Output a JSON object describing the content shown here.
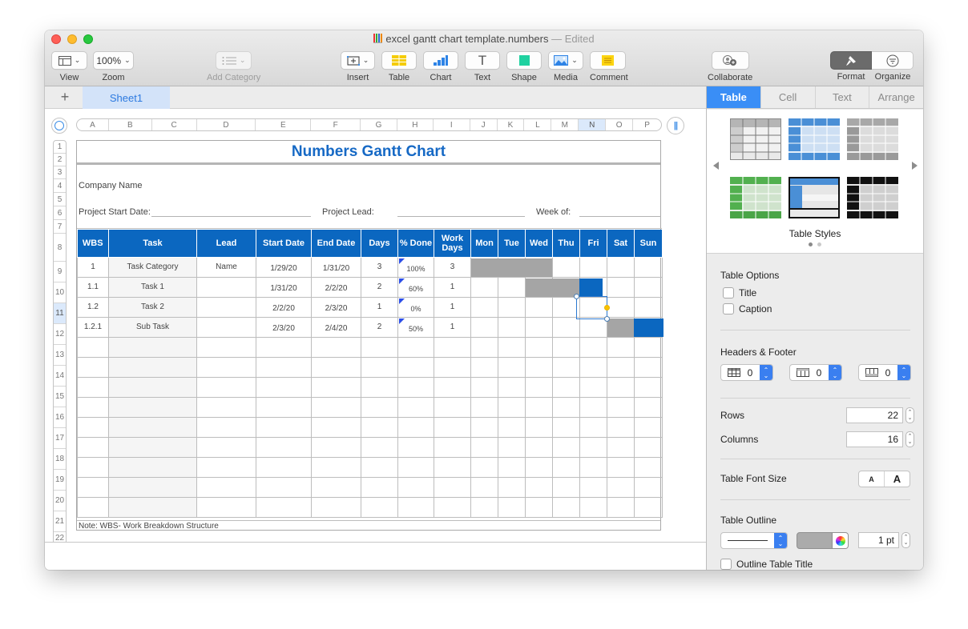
{
  "window": {
    "title": "excel gantt chart template.numbers",
    "edited_label": "— Edited"
  },
  "toolbar": {
    "view_label": "View",
    "zoom_value": "100%",
    "zoom_label": "Zoom",
    "add_category_label": "Add Category",
    "insert_label": "Insert",
    "table_label": "Table",
    "chart_label": "Chart",
    "text_label": "Text",
    "shape_label": "Shape",
    "media_label": "Media",
    "comment_label": "Comment",
    "collaborate_label": "Collaborate",
    "format_label": "Format",
    "organize_label": "Organize"
  },
  "sheets": {
    "add_label": "+",
    "tabs": [
      {
        "label": "Sheet1",
        "active": true
      }
    ]
  },
  "grid_headers": {
    "columns": [
      "A",
      "B",
      "C",
      "D",
      "E",
      "F",
      "G",
      "H",
      "I",
      "J",
      "K",
      "L",
      "M",
      "N",
      "O",
      "P"
    ],
    "selected_column": "N",
    "rows": [
      "1",
      "2",
      "3",
      "4",
      "5",
      "6",
      "7",
      "8",
      "9",
      "10",
      "11",
      "12",
      "13",
      "14",
      "15",
      "16",
      "17",
      "18",
      "19",
      "20",
      "21",
      "22"
    ],
    "selected_row": "11"
  },
  "spreadsheet": {
    "title": "Numbers Gantt Chart",
    "company_label": "Company Name",
    "project_start_label": "Project Start Date:",
    "project_lead_label": "Project Lead:",
    "week_of_label": "Week of:",
    "columns": [
      "WBS",
      "Task",
      "Lead",
      "Start Date",
      "End Date",
      "Days",
      "% Done",
      "Work Days",
      "Mon",
      "Tue",
      "Wed",
      "Thu",
      "Fri",
      "Sat",
      "Sun"
    ],
    "rows": [
      {
        "wbs": "1",
        "task": "Task Category",
        "lead": "Name",
        "start": "1/29/20",
        "end": "1/31/20",
        "days": "3",
        "pct": "100%",
        "work_days": "3"
      },
      {
        "wbs": "1.1",
        "task": "Task 1",
        "lead": "",
        "start": "1/31/20",
        "end": "2/2/20",
        "days": "2",
        "pct": "60%",
        "work_days": "1"
      },
      {
        "wbs": "1.2",
        "task": "Task 2",
        "lead": "",
        "start": "2/2/20",
        "end": "2/3/20",
        "days": "1",
        "pct": "0%",
        "work_days": "1"
      },
      {
        "wbs": "1.2.1",
        "task": "Sub Task",
        "lead": "",
        "start": "2/3/20",
        "end": "2/4/20",
        "days": "2",
        "pct": "50%",
        "work_days": "1"
      }
    ],
    "empty_rows": 9,
    "note": "Note: WBS- Work Breakdown Structure",
    "colors": {
      "header": "#0b67c0",
      "title": "#1669c5",
      "bar_done": "#a5a5a5",
      "bar_remaining": "#0b67c0"
    }
  },
  "inspector": {
    "tabs": [
      {
        "label": "Table",
        "active": true
      },
      {
        "label": "Cell",
        "active": false
      },
      {
        "label": "Text",
        "active": false
      },
      {
        "label": "Arrange",
        "active": false
      }
    ],
    "table_styles_label": "Table Styles",
    "table_options_label": "Table Options",
    "title_option": "Title",
    "caption_option": "Caption",
    "headers_footer_label": "Headers & Footer",
    "header_rows": "0",
    "header_columns": "0",
    "footer_rows": "0",
    "rows_label": "Rows",
    "rows_value": "22",
    "columns_label": "Columns",
    "columns_value": "16",
    "font_size_label": "Table Font Size",
    "font_small": "A",
    "font_large": "A",
    "outline_label": "Table Outline",
    "outline_width": "1 pt",
    "outline_color": "#ababab",
    "outline_title_label": "Outline Table Title",
    "accent": "#3a8ef6"
  }
}
